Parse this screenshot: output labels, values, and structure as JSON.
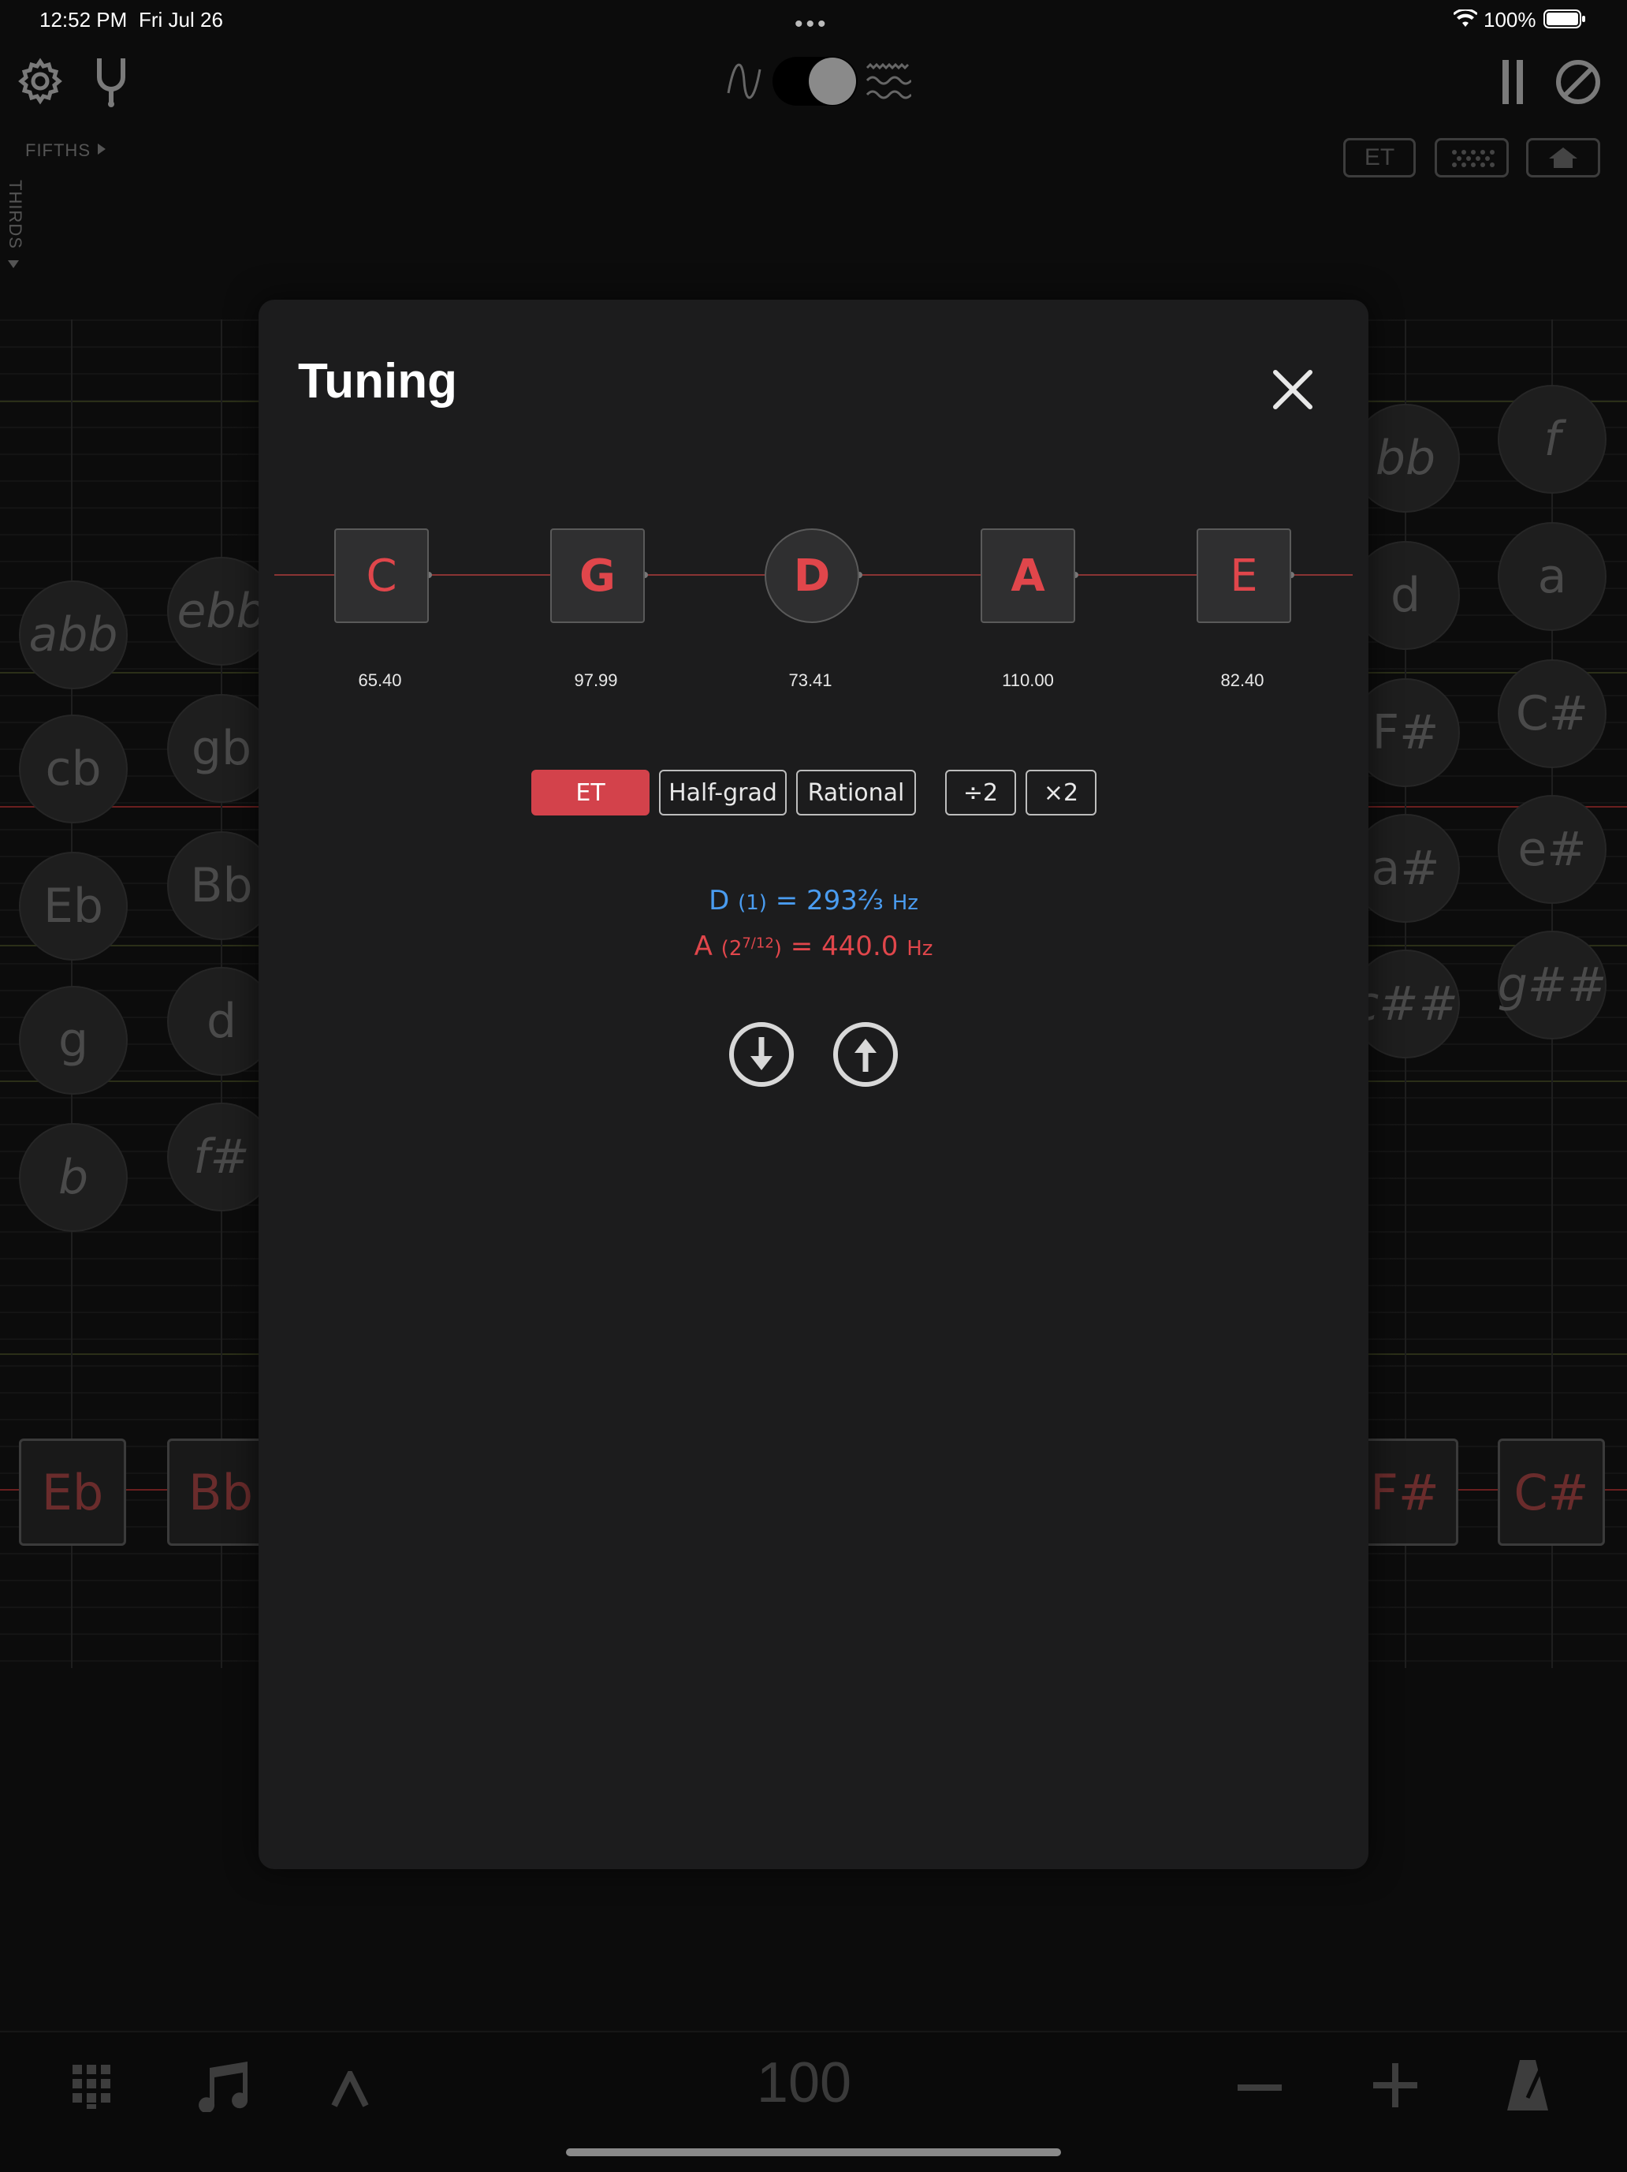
{
  "status_bar": {
    "time": "12:52 PM",
    "date": "Fri Jul 26",
    "battery": "100%"
  },
  "header": {
    "fifths_label": "FIFTHS",
    "thirds_label": "THIRDS",
    "et_label": "ET"
  },
  "background_notes": {
    "left_col1": [
      "abb",
      "cb",
      "Eb",
      "g",
      "b"
    ],
    "left_col2": [
      "ebb",
      "gb",
      "Bb",
      "d",
      "f#"
    ],
    "right_col1": [
      "bb",
      "d",
      "F#",
      "a#",
      "c##"
    ],
    "right_col2": [
      "f",
      "a",
      "C#",
      "e#",
      "g##"
    ],
    "bottom_left": [
      "Eb",
      "Bb"
    ],
    "bottom_right": [
      "F#",
      "C#"
    ]
  },
  "bottom_toolbar": {
    "tempo": "100"
  },
  "modal": {
    "title": "Tuning",
    "notes": [
      {
        "label": "C",
        "freq": "65.40"
      },
      {
        "label": "G",
        "freq": "97.99"
      },
      {
        "label": "D",
        "freq": "73.41"
      },
      {
        "label": "A",
        "freq": "110.00"
      },
      {
        "label": "E",
        "freq": "82.40"
      }
    ],
    "buttons": {
      "et": "ET",
      "half_grad": "Half-grad",
      "rational": "Rational",
      "div2": "÷2",
      "mul2": "×2"
    },
    "ref_blue": {
      "note": "D",
      "ratio": "(1)",
      "eq": "= 293⅔",
      "unit": "Hz"
    },
    "ref_red": {
      "note": "A",
      "ratio_open": "(2",
      "ratio_exp": "7/12",
      "ratio_close": ")",
      "eq": "= 440.0",
      "unit": "Hz"
    }
  },
  "colors": {
    "accent_red": "#d3424b",
    "note_red": "#e0464b",
    "ref_blue": "#4a9cf0",
    "modal_bg": "#1c1c1d"
  }
}
